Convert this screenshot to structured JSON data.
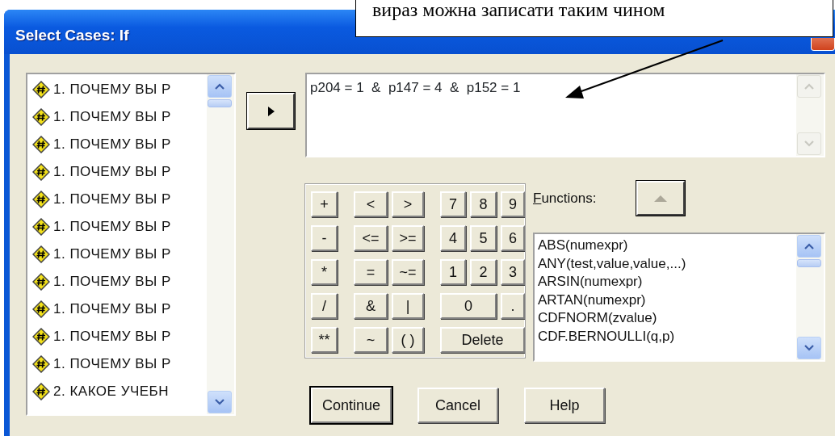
{
  "annotation": {
    "text": "вираз можна записати таким чином"
  },
  "window": {
    "title": "Select Cases: If"
  },
  "variables": [
    {
      "label": "1. ПОЧЕМУ ВЫ Р"
    },
    {
      "label": "1. ПОЧЕМУ ВЫ Р"
    },
    {
      "label": "1. ПОЧЕМУ ВЫ Р"
    },
    {
      "label": "1. ПОЧЕМУ ВЫ Р"
    },
    {
      "label": "1. ПОЧЕМУ ВЫ Р"
    },
    {
      "label": "1. ПОЧЕМУ ВЫ Р"
    },
    {
      "label": "1. ПОЧЕМУ ВЫ Р"
    },
    {
      "label": "1. ПОЧЕМУ ВЫ Р"
    },
    {
      "label": "1. ПОЧЕМУ ВЫ Р"
    },
    {
      "label": "1. ПОЧЕМУ ВЫ Р"
    },
    {
      "label": "1. ПОЧЕМУ ВЫ Р"
    },
    {
      "label": "2. КАКОЕ УЧЕБН"
    }
  ],
  "expression": {
    "value": "p204 = 1  &  p147 = 4  &  p152 = 1"
  },
  "keypad": [
    [
      {
        "label": "+",
        "kind": "key"
      },
      {
        "label": "<",
        "kind": "key"
      },
      {
        "label": ">",
        "kind": "key"
      },
      {
        "label": "7",
        "kind": "key"
      },
      {
        "label": "8",
        "kind": "key"
      },
      {
        "label": "9",
        "kind": "key"
      }
    ],
    [
      {
        "label": "-",
        "kind": "key"
      },
      {
        "label": "<=",
        "kind": "key"
      },
      {
        "label": ">=",
        "kind": "key"
      },
      {
        "label": "4",
        "kind": "key"
      },
      {
        "label": "5",
        "kind": "key"
      },
      {
        "label": "6",
        "kind": "key"
      }
    ],
    [
      {
        "label": "*",
        "kind": "key"
      },
      {
        "label": "=",
        "kind": "key"
      },
      {
        "label": "~=",
        "kind": "key"
      },
      {
        "label": "1",
        "kind": "key"
      },
      {
        "label": "2",
        "kind": "key"
      },
      {
        "label": "3",
        "kind": "key"
      }
    ],
    [
      {
        "label": "/",
        "kind": "key"
      },
      {
        "label": "&",
        "kind": "key"
      },
      {
        "label": "|",
        "kind": "key"
      },
      {
        "label": "0",
        "kind": "wide"
      },
      {
        "label": ".",
        "kind": "key"
      }
    ],
    [
      {
        "label": "**",
        "kind": "key"
      },
      {
        "label": "~",
        "kind": "key"
      },
      {
        "label": "( )",
        "kind": "key"
      },
      {
        "label": "Delete",
        "kind": "widest"
      }
    ]
  ],
  "functions": {
    "label": "Functions:",
    "items": [
      {
        "label": "ABS(numexpr)"
      },
      {
        "label": "ANY(test,value,value,...)"
      },
      {
        "label": "ARSIN(numexpr)"
      },
      {
        "label": "ARTAN(numexpr)"
      },
      {
        "label": "CDFNORM(zvalue)"
      },
      {
        "label": "CDF.BERNOULLI(q,p)"
      }
    ]
  },
  "buttons": [
    {
      "label": "Continue",
      "default": true
    },
    {
      "label": "Cancel",
      "default": false
    },
    {
      "label": "Help",
      "default": false
    }
  ]
}
